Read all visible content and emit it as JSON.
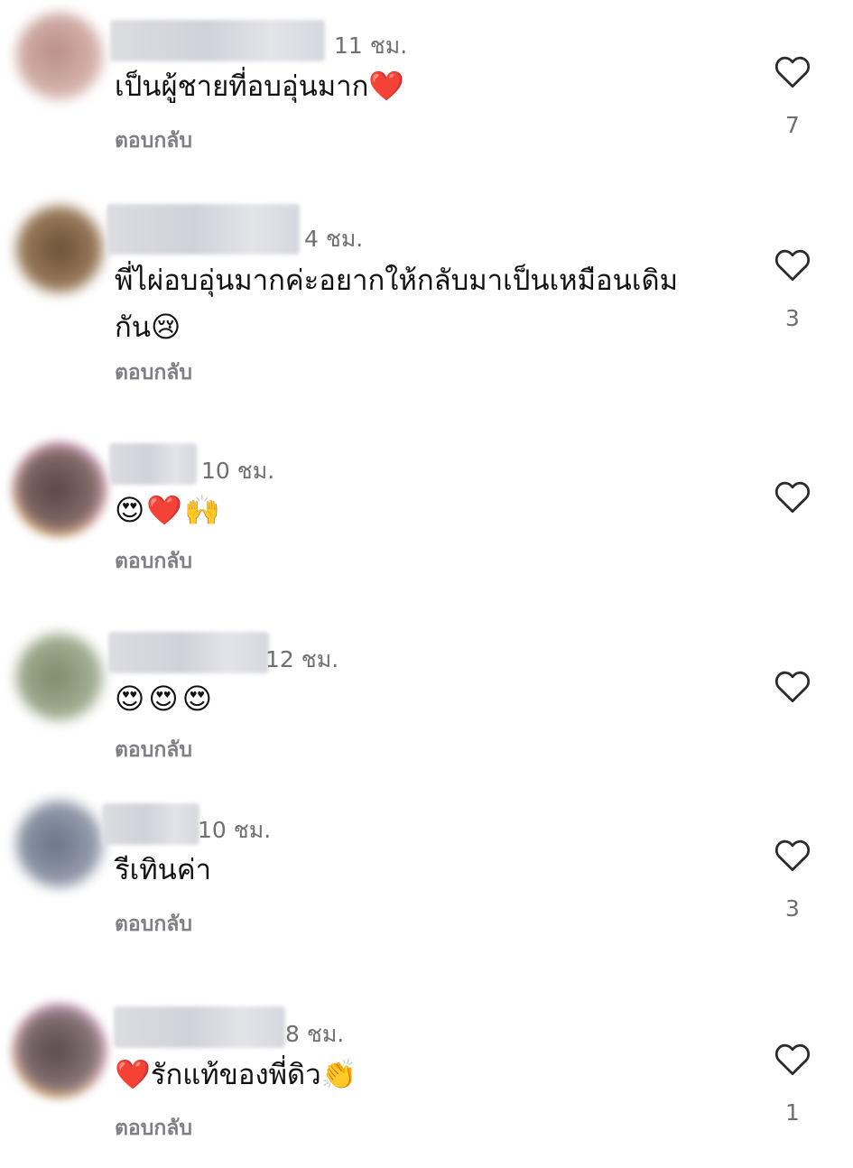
{
  "comments": [
    {
      "time": "11 ชม.",
      "text": "เป็นผู้ชายที่อบอุ่นมาก",
      "emoji_after": "❤️",
      "reply_label": "ตอบกลับ",
      "likes": "7",
      "avatar_color": "#c9a19a"
    },
    {
      "time": "4 ชม.",
      "text_line1": "พี่ไผ่อบอุ่นมากค่ะอยากให้กลับมาเป็นเหมือนเดิม",
      "text_line2": "กัน",
      "emoji_after": "😢",
      "reply_label": "ตอบกลับ",
      "likes": "3",
      "avatar_color": "#8a6b4c"
    },
    {
      "time": "10 ชม.",
      "emojis": "😍❤️🙌",
      "reply_label": "ตอบกลับ",
      "avatar_color": "#6b5552"
    },
    {
      "time": "12 ชม.",
      "emojis": "😍😍😍",
      "reply_label": "ตอบกลับ",
      "avatar_color": "#8c9a7c"
    },
    {
      "time": "10 ชม.",
      "text": "รีเทินค่า",
      "reply_label": "ตอบกลับ",
      "likes": "3",
      "avatar_color": "#7a8392"
    },
    {
      "time": "8 ชม.",
      "emoji_before": "❤️",
      "text": "รักแท้ของพี่ดิว",
      "emoji_after": "👏",
      "reply_label": "ตอบกลับ",
      "likes": "1",
      "avatar_color": "#6c5a5c"
    }
  ],
  "icons": {
    "like": "heart-outline-icon"
  },
  "colors": {
    "secondary_text": "#6e6e73",
    "reply_text": "#7f7f85",
    "primary_text": "#111111"
  }
}
